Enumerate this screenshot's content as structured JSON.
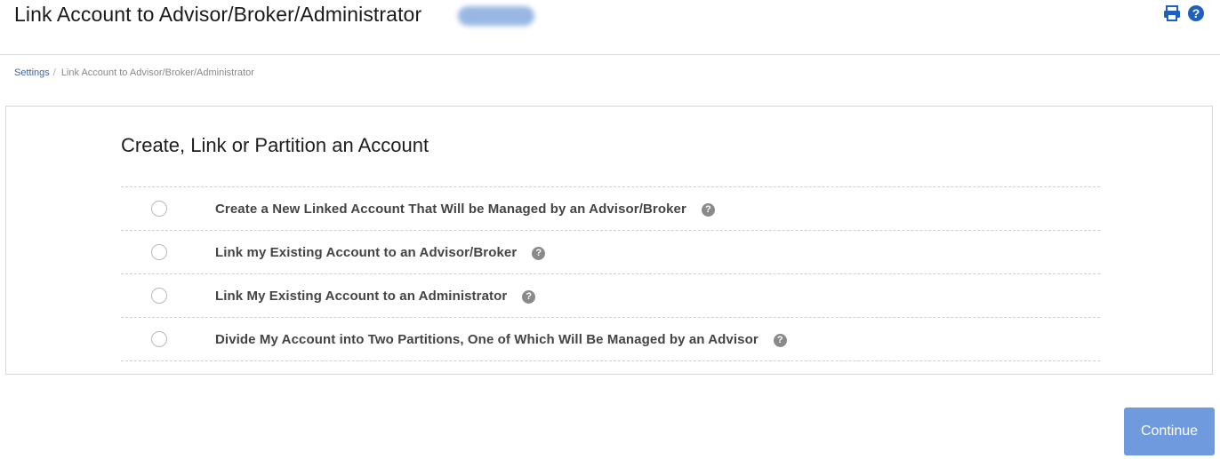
{
  "header": {
    "title": "Link Account to Advisor/Broker/Administrator",
    "icons": {
      "print": "print-icon",
      "help": "help-icon"
    },
    "accent_color": "#1f5fbf"
  },
  "breadcrumb": {
    "items": [
      "Settings",
      "Link Account to Advisor/Broker/Administrator"
    ],
    "separator": "/"
  },
  "main": {
    "section_title": "Create, Link or Partition an Account",
    "options": [
      {
        "label": "Create a New Linked Account That Will be Managed by an Advisor/Broker",
        "help": "?",
        "selected": false
      },
      {
        "label": "Link my Existing Account to an Advisor/Broker",
        "help": "?",
        "selected": false
      },
      {
        "label": "Link My Existing Account to an Administrator",
        "help": "?",
        "selected": false
      },
      {
        "label": "Divide My Account into Two Partitions, One of Which Will Be Managed by an Advisor",
        "help": "?",
        "selected": false
      }
    ]
  },
  "footer": {
    "continue_label": "Continue",
    "continue_color": "#6f9ade"
  }
}
